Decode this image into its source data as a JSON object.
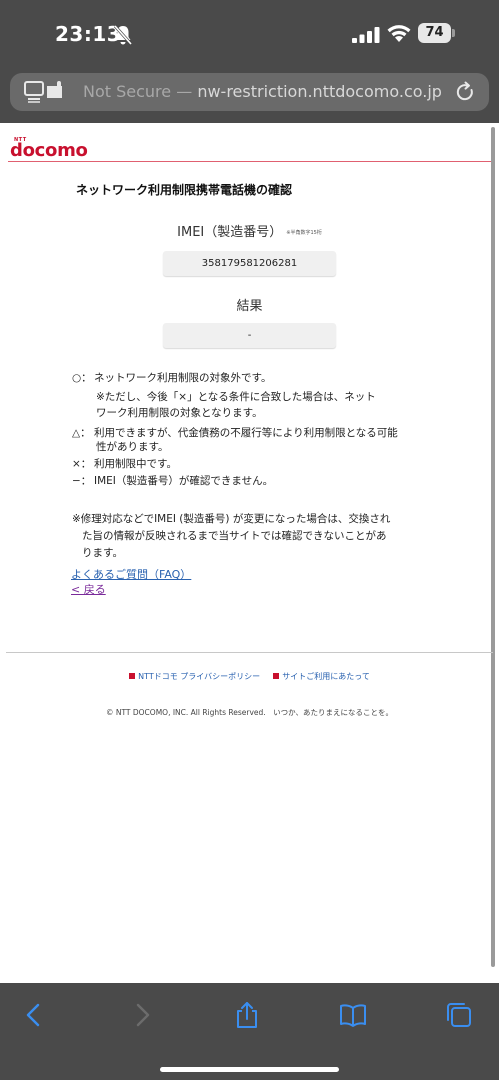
{
  "status_bar": {
    "time": "23:13",
    "battery": "74"
  },
  "url_bar": {
    "security": "Not Secure —",
    "domain": "nw-restriction.nttdocomo.co.jp"
  },
  "brand": {
    "small": "NTT",
    "logo": "docomo",
    "color": "#c8102e"
  },
  "page": {
    "title": "ネットワーク利用制限携帯電話機の確認",
    "imei_label": "IMEI（製造番号）",
    "imei_note": "※半角数字15桁",
    "imei_value": "358179581206281",
    "result_label": "結果",
    "result_value": "-",
    "legend": [
      {
        "sym": "○：",
        "text": "ネットワーク利用制限の対象外です。"
      },
      {
        "sym": "",
        "text": "※ただし、今後「×」となる条件に合致した場合は、ネット"
      },
      {
        "sym": "",
        "text": "ワーク利用制限の対象となります。"
      },
      {
        "sym": "△：",
        "text": "利用できますが、代金債務の不履行等により利用制限となる可能"
      },
      {
        "sym": "",
        "text": "性があります。"
      },
      {
        "sym": "×：",
        "text": "利用制限中です。"
      },
      {
        "sym": "−：",
        "text": "IMEI（製造番号）が確認できません。"
      }
    ],
    "footnote": [
      "※修理対応などでIMEI (製造番号) が変更になった場合は、交換され",
      "た旨の情報が反映されるまで当サイトでは確認できないことがあ",
      "ります。"
    ],
    "faq_link": "よくあるご質問（FAQ）",
    "back_link": "< 戻る"
  },
  "footer": {
    "privacy_link": "NTTドコモ プライバシーポリシー",
    "terms_link": "サイトご利用にあたって",
    "copyright": "© NTT DOCOMO, INC. All Rights Reserved.　いつか、あたりまえになることを。"
  },
  "toolbar": {
    "icons": [
      "back-icon",
      "forward-icon",
      "share-icon",
      "bookmarks-icon",
      "tabs-icon"
    ],
    "accent": "#3a8ef0"
  }
}
